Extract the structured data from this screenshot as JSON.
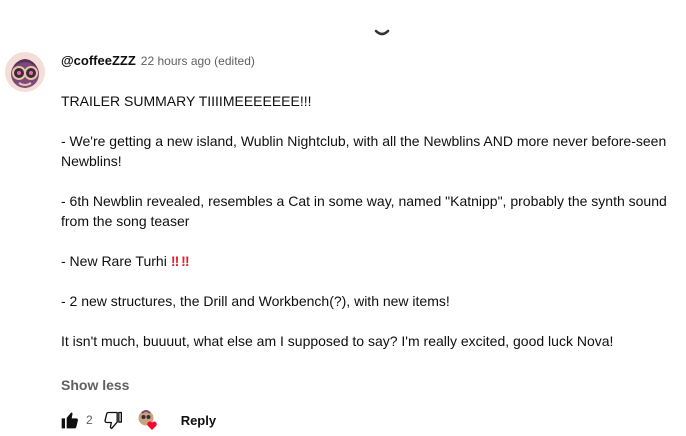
{
  "comment": {
    "author": "@coffeeZZZ",
    "timestamp": "22 hours ago (edited)",
    "paragraphs": [
      "TRAILER SUMMARY TIIIIMEEEEEEE!!!",
      "- We're getting a new island, Wublin Nightclub, with all the Newblins AND more never before-seen Newblins!",
      "- 6th Newblin revealed, resembles a Cat in some way, named \"Katnipp\", probably the synth sound from the song teaser",
      "- New Rare Turhi",
      "- 2 new structures, the Drill and Workbench(?), with new items!",
      "It isn't much, buuuut, what else am I supposed to say? I'm really excited, good luck Nova!"
    ],
    "emphasis": "‼ ‼",
    "show_less": "Show less",
    "like_count": "2",
    "reply_label": "Reply"
  },
  "icons": {
    "spinner": "loading-spinner-icon",
    "like": "thumbs-up-filled-icon",
    "dislike": "thumbs-down-outline-icon",
    "creator_heart": "creator-heart-icon"
  },
  "colors": {
    "text_primary": "#0f0f0f",
    "text_secondary": "#606060",
    "emphasis_red": "#e0242f",
    "heart_red": "#ff0033"
  }
}
